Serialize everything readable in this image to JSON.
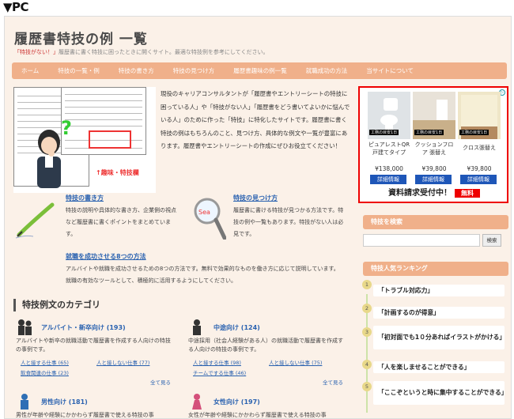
{
  "label": "▼PC",
  "site": {
    "title": "履歴書特技の例 一覧",
    "desc_prefix": "「特技がない！」",
    "desc_rest": "履歴書に書く特技に困ったときに開くサイト。最適な特技例を参考にしてください。",
    "nav": [
      "ホーム",
      "特技の一覧・例",
      "特技の書き方",
      "特技の見つけ方",
      "履歴書趣味の例一覧",
      "就職成功の方法",
      "当サイトについて"
    ]
  },
  "hero": {
    "highlight_label": "↑趣味・特技欄",
    "intro": "現役のキャリアコンサルタントが「履歴書やエントリーシートの特技に困っている人」や「特技がない人」「履歴書をどう書いてよいかに悩んでいる人」のために作った「特技」に特化したサイトです。履歴書に書く特技の例はもちろんのこと、見つけ方、具体的な例文や一覧が豊富にあります。履歴書やエントリーシートの作成にぜひお役立てください！"
  },
  "ad": {
    "items": [
      {
        "tag": "工務の目安1日",
        "name": "ピュアレストQR 戸建てタイプ",
        "price": "¥138,000",
        "btn": "詳細情報"
      },
      {
        "tag": "工務の目安1日",
        "name": "クッションフロア 張替え",
        "price": "¥39,800",
        "btn": "詳細情報"
      },
      {
        "tag": "工務の目安1日",
        "name": "クロス張替え",
        "price": "¥39,800",
        "btn": "詳細情報"
      }
    ],
    "banner": "資料請求受付中！",
    "free": "無料",
    "choice": "▷"
  },
  "features": [
    {
      "title": "特技の書き方",
      "text": "特技の説明や具体的な書き方、企業側の視点など履歴書に書くポイントをまとめています。"
    },
    {
      "title": "特技の見つけ方",
      "text": "履歴書に書ける特技が見つかる方法です。特技の例や一覧もあります。特技がない人は必見です。"
    },
    {
      "title": "就職を成功させる8つの方法",
      "text": "アルバイトや就職を成功させるための8つの方法です。無料で効果的なものを働き方に応じて説明しています。就職の有効なツールとして、積極的に活用するようにしてください。"
    }
  ],
  "categories": {
    "heading": "特技例文のカテゴリ",
    "items": [
      {
        "title": "アルバイト・新卒向け (193)",
        "desc": "アルバイトや新卒の就職活動で履歴書を作成する人向けの特技の事例です。",
        "links": [
          "人と接する仕事 (65)",
          "人と接しない仕事 (77)",
          "飲食関連の仕事 (23)"
        ],
        "more": "全て見る"
      },
      {
        "title": "中途向け (124)",
        "desc": "中途採用（社会人経験がある人）の就職活動で履歴書を作成する人向けの特技の事例です。",
        "links": [
          "人と接する仕事 (98)",
          "人と接しない仕事 (75)",
          "チームでする仕事 (46)"
        ],
        "more": "全て見る"
      },
      {
        "title": "男性向け (181)",
        "desc": "男性が年齢や経験にかかわらず履歴書で使える特技の事",
        "links": [],
        "more": ""
      },
      {
        "title": "女性向け (197)",
        "desc": "女性が年齢や経験にかかわらず履歴書で使える特技の事",
        "links": [],
        "more": ""
      }
    ]
  },
  "sidebar": {
    "search_head": "特技を検索",
    "search_btn": "検索",
    "rank_head": "特技人気ランキング",
    "ranking": [
      {
        "num": "1",
        "text": "「トラブル対応力」"
      },
      {
        "num": "2",
        "text": "「計画するのが得意」"
      },
      {
        "num": "3",
        "text": "「初対面でも1０分あればイラストがかける」"
      },
      {
        "num": "4",
        "text": "「人を楽しませることができる」"
      },
      {
        "num": "5",
        "text": "「ここぞというと時に集中することができる」"
      }
    ]
  }
}
